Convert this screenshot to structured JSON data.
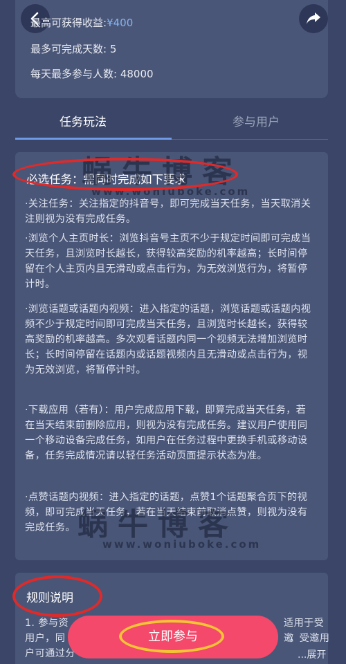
{
  "header": {
    "back_icon": "chevron-left-icon",
    "share_icon": "share-arrow-icon",
    "stats": {
      "max_earnings_label": "最高可获得收益:",
      "max_earnings_value": "¥400",
      "max_days_label": "最多可完成天数:",
      "max_days_value": "5",
      "max_participants_label": "每天最多参与人数:",
      "max_participants_value": "48000"
    }
  },
  "tabs": [
    {
      "label": "任务玩法",
      "active": true
    },
    {
      "label": "参与用户",
      "active": false
    }
  ],
  "required_tasks": {
    "title": "必选任务：需同时完成如下要求",
    "items": [
      "·关注任务：关注指定的抖音号，即可完成当天任务，当天取消关注则视为没有完成任务。",
      "·浏览个人主页时长：浏览抖音号主页不少于规定时间即可完成当天任务，且浏览时长越长，获得较高奖励的机率越高；长时间停留在个人主页内且无滑动或点击行为，为无效浏览行为，将暂停计时。",
      "·浏览话题或话题内视频：进入指定的话题，浏览话题或话题内视频不少于规定时间即可完成当天任务，且浏览时长越长，获得较高奖励的机率越高。多次观看话题内同一个视频无法增加浏览时长；长时间停留在话题内或话题视频内且无滑动或点击行为，视为无效浏览，将暂停计时。",
      "·下载应用（若有）：用户完成应用下载，即算完成当天任务，若在当天结束前删除应用，则视为没有完成任务。建议用户使用同一个移动设备完成任务，如用户在任务过程中更换手机或移动设备，任务完成情况请以轻任务活动页面提示状态为准。",
      "·点赞话题内视频：进入指定的话题，点赞1个话题聚合页下的视频，即可完成当天任务，若在当天结束前取消点赞，则视为没有完成任务。"
    ]
  },
  "rules": {
    "title": "规则说明",
    "line1_left": "1. 参与资",
    "line1_right": "适用于受邀",
    "line2_left": "用户，同",
    "line2_right": "，受邀用",
    "line3_left": "户可通过分",
    "expand_label": "...展开"
  },
  "watermark": {
    "brand": "蜗牛博客",
    "url": "www.woniuboke.com"
  },
  "cta": {
    "label": "立即参与"
  },
  "colors": {
    "background": "#3a4567",
    "card": "#4a5677",
    "accent_blue": "#6f9ae8",
    "cta_pink": "#f4496a",
    "annotation_red": "#e02a2a",
    "annotation_yellow": "#f3c534"
  }
}
